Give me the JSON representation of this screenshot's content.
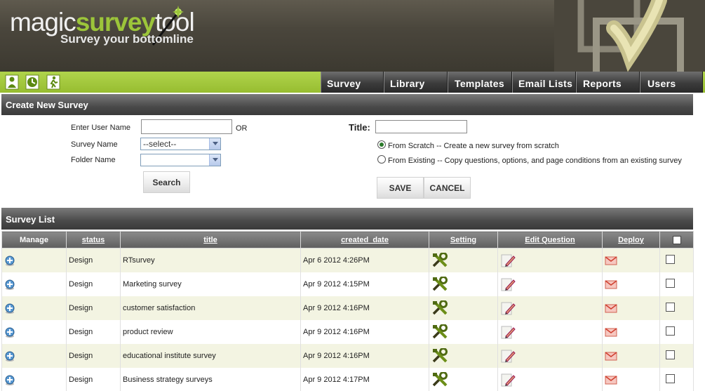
{
  "brand": {
    "logo_part1": "magic",
    "logo_part2": "survey",
    "logo_part3": "tool",
    "tagline": "Survey your bottomline",
    "accent_green": "#97bd30"
  },
  "toolbar_icons": [
    "user-icon",
    "clock-icon",
    "exit-icon"
  ],
  "nav_tabs": [
    {
      "label": "Survey"
    },
    {
      "label": "Library"
    },
    {
      "label": "Templates"
    },
    {
      "label": "Email Lists"
    },
    {
      "label": "Reports"
    },
    {
      "label": "Users"
    }
  ],
  "create_section": {
    "title": "Create New Survey",
    "user_name_label": "Enter User Name",
    "user_name_value": "",
    "or_label": "OR",
    "survey_name_label": "Survey Name",
    "survey_name_selected": "--select--",
    "folder_name_label": "Folder Name",
    "folder_name_selected": "",
    "search_button": "Search",
    "title_label": "Title:",
    "title_value": "",
    "option_scratch": "From Scratch -- Create a new survey from scratch",
    "option_existing": "From Existing -- Copy questions, options, and page conditions from an existing survey",
    "selected_option": "scratch",
    "save_button": "SAVE",
    "cancel_button": "CANCEL"
  },
  "list_section": {
    "title": "Survey List",
    "columns": [
      "Manage",
      "status",
      "title",
      "created_date",
      "Setting",
      "Edit Question",
      "Deploy"
    ],
    "rows": [
      {
        "status": "Design",
        "title": "RTsurvey",
        "created": "Apr 6 2012 4:26PM"
      },
      {
        "status": "Design",
        "title": "Marketing survey",
        "created": "Apr 9 2012 4:15PM"
      },
      {
        "status": "Design",
        "title": "customer satisfaction",
        "created": "Apr 9 2012 4:16PM"
      },
      {
        "status": "Design",
        "title": "product review",
        "created": "Apr 9 2012 4:16PM"
      },
      {
        "status": "Design",
        "title": "educational institute survey",
        "created": "Apr 9 2012 4:16PM"
      },
      {
        "status": "Design",
        "title": "Business strategy surveys",
        "created": "Apr 9 2012 4:17PM"
      }
    ]
  }
}
